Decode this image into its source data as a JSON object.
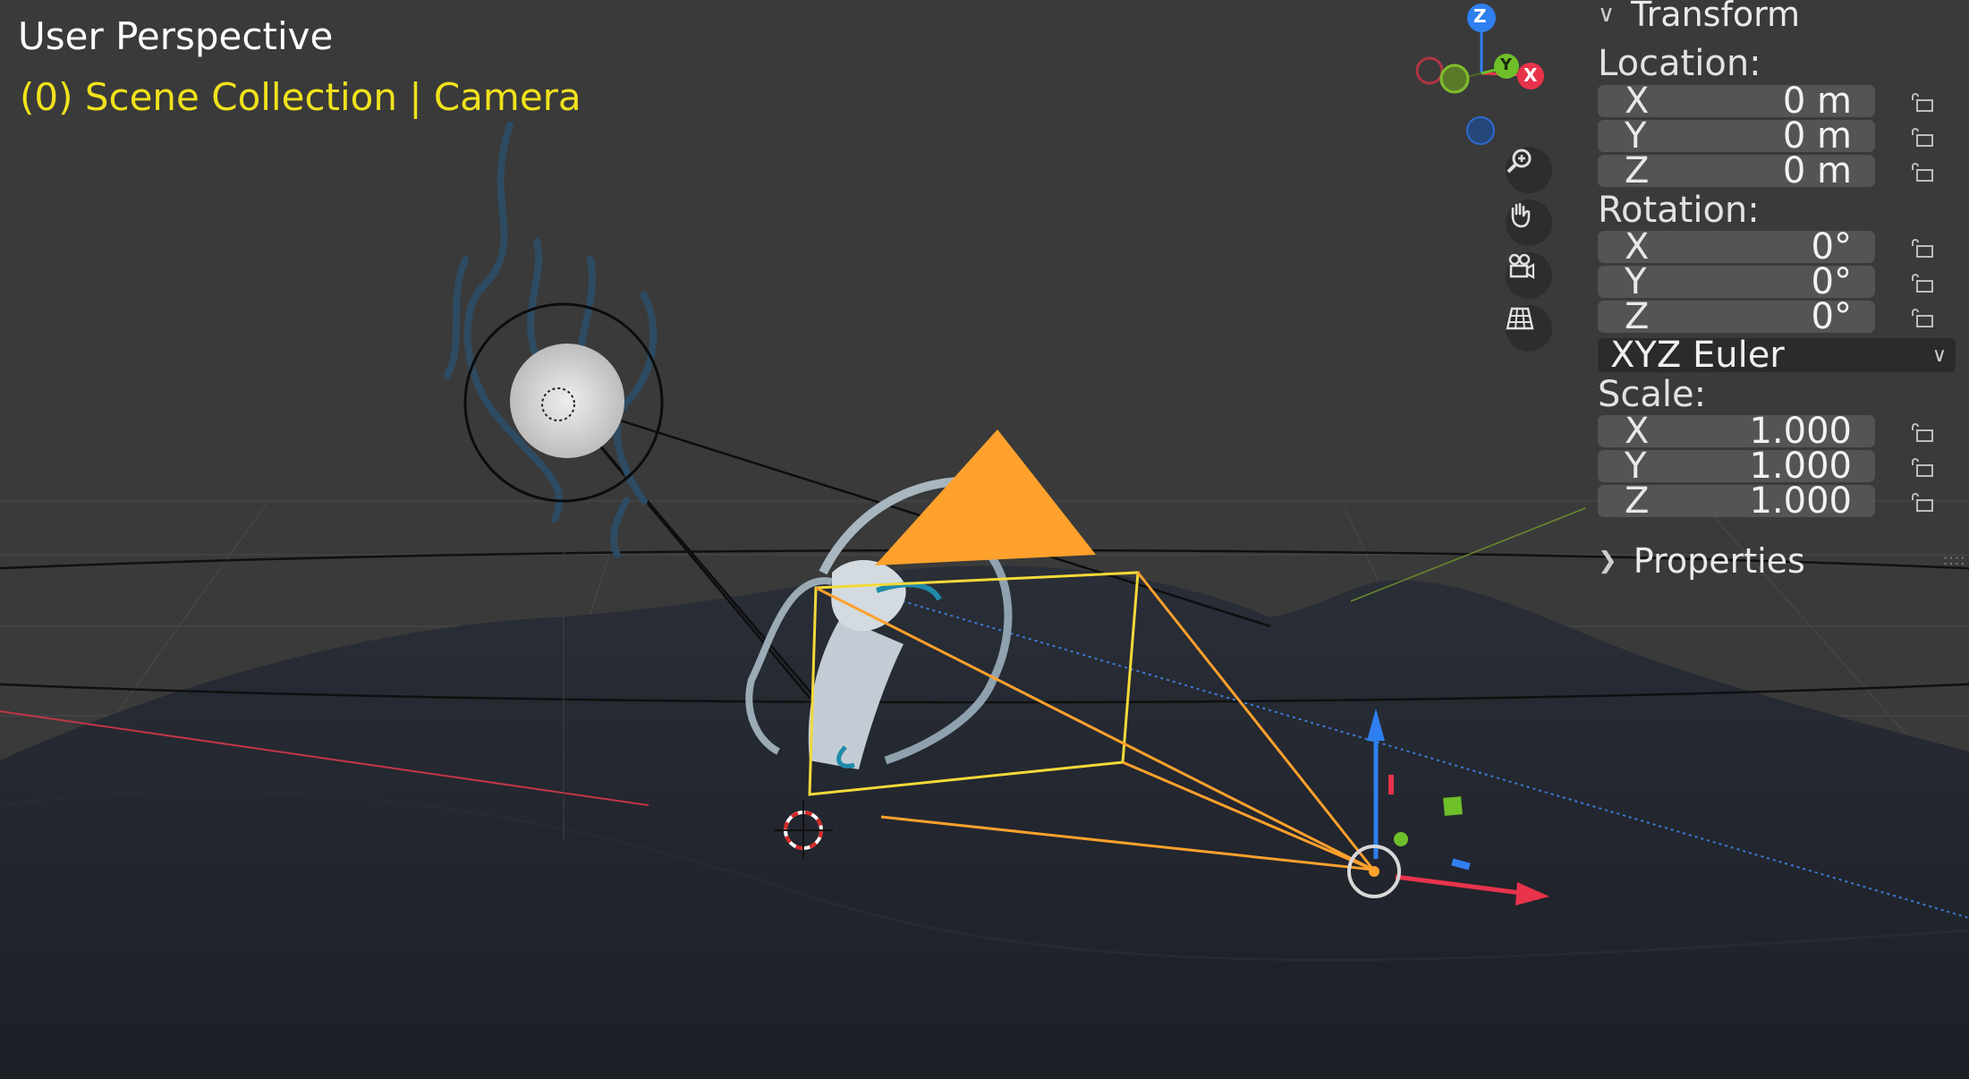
{
  "viewport": {
    "title": "User Perspective",
    "subtitle": "(0) Scene Collection | Camera"
  },
  "gizmo": {
    "axes": {
      "z": "Z",
      "y": "Y",
      "x": "X"
    },
    "buttons": [
      "zoom-icon",
      "hand-pan-icon",
      "camera-view-icon",
      "grid-perspective-icon"
    ]
  },
  "sidebar": {
    "transform_header": "Transform",
    "location_label": "Location:",
    "location": [
      {
        "axis": "X",
        "value": "0 m"
      },
      {
        "axis": "Y",
        "value": "0 m"
      },
      {
        "axis": "Z",
        "value": "0 m"
      }
    ],
    "rotation_label": "Rotation:",
    "rotation": [
      {
        "axis": "X",
        "value": "0°"
      },
      {
        "axis": "Y",
        "value": "0°"
      },
      {
        "axis": "Z",
        "value": "0°"
      }
    ],
    "rotation_mode": "XYZ Euler",
    "scale_label": "Scale:",
    "scale": [
      {
        "axis": "X",
        "value": "1.000"
      },
      {
        "axis": "Y",
        "value": "1.000"
      },
      {
        "axis": "Z",
        "value": "1.000"
      }
    ],
    "properties_header": "Properties"
  },
  "colors": {
    "background": "#3a3a3a",
    "selected_text": "#f0e21c",
    "camera_orange": "#ffa12c",
    "axis_x": "#e8334b",
    "axis_y": "#7fbf2a",
    "axis_z": "#2f7ff0"
  }
}
